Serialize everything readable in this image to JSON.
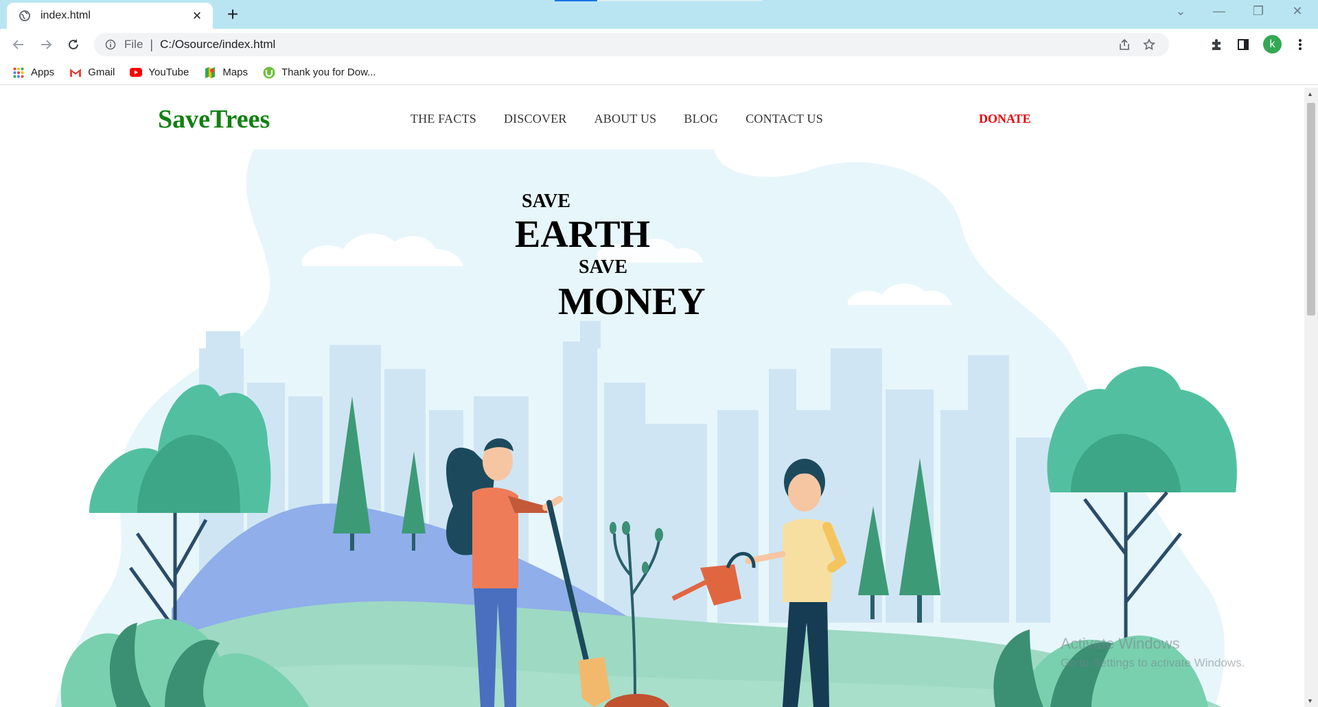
{
  "browser": {
    "tab_title": "index.html",
    "url_scheme": "File",
    "url": "C:/Osource/index.html",
    "profile_initial": "k",
    "bookmarks": [
      {
        "label": "Apps",
        "icon": "apps-grid-icon"
      },
      {
        "label": "Gmail",
        "icon": "gmail-icon"
      },
      {
        "label": "YouTube",
        "icon": "youtube-icon"
      },
      {
        "label": "Maps",
        "icon": "maps-icon"
      },
      {
        "label": "Thank you for Dow...",
        "icon": "utorrent-icon"
      }
    ]
  },
  "site": {
    "logo": "SaveTrees",
    "menu": [
      "THE FACTS",
      "DISCOVER",
      "ABOUT US",
      "BLOG",
      "CONTACT US"
    ],
    "donate": "DONATE",
    "brand_color": "#118011",
    "donate_color": "#e60000"
  },
  "hero": {
    "line1": "SAVE",
    "line2": "EARTH",
    "line3": "SAVE",
    "line4": "MONEY"
  },
  "os_watermark": {
    "title": "Activate Windows",
    "subtitle": "Go to Settings to activate Windows."
  }
}
